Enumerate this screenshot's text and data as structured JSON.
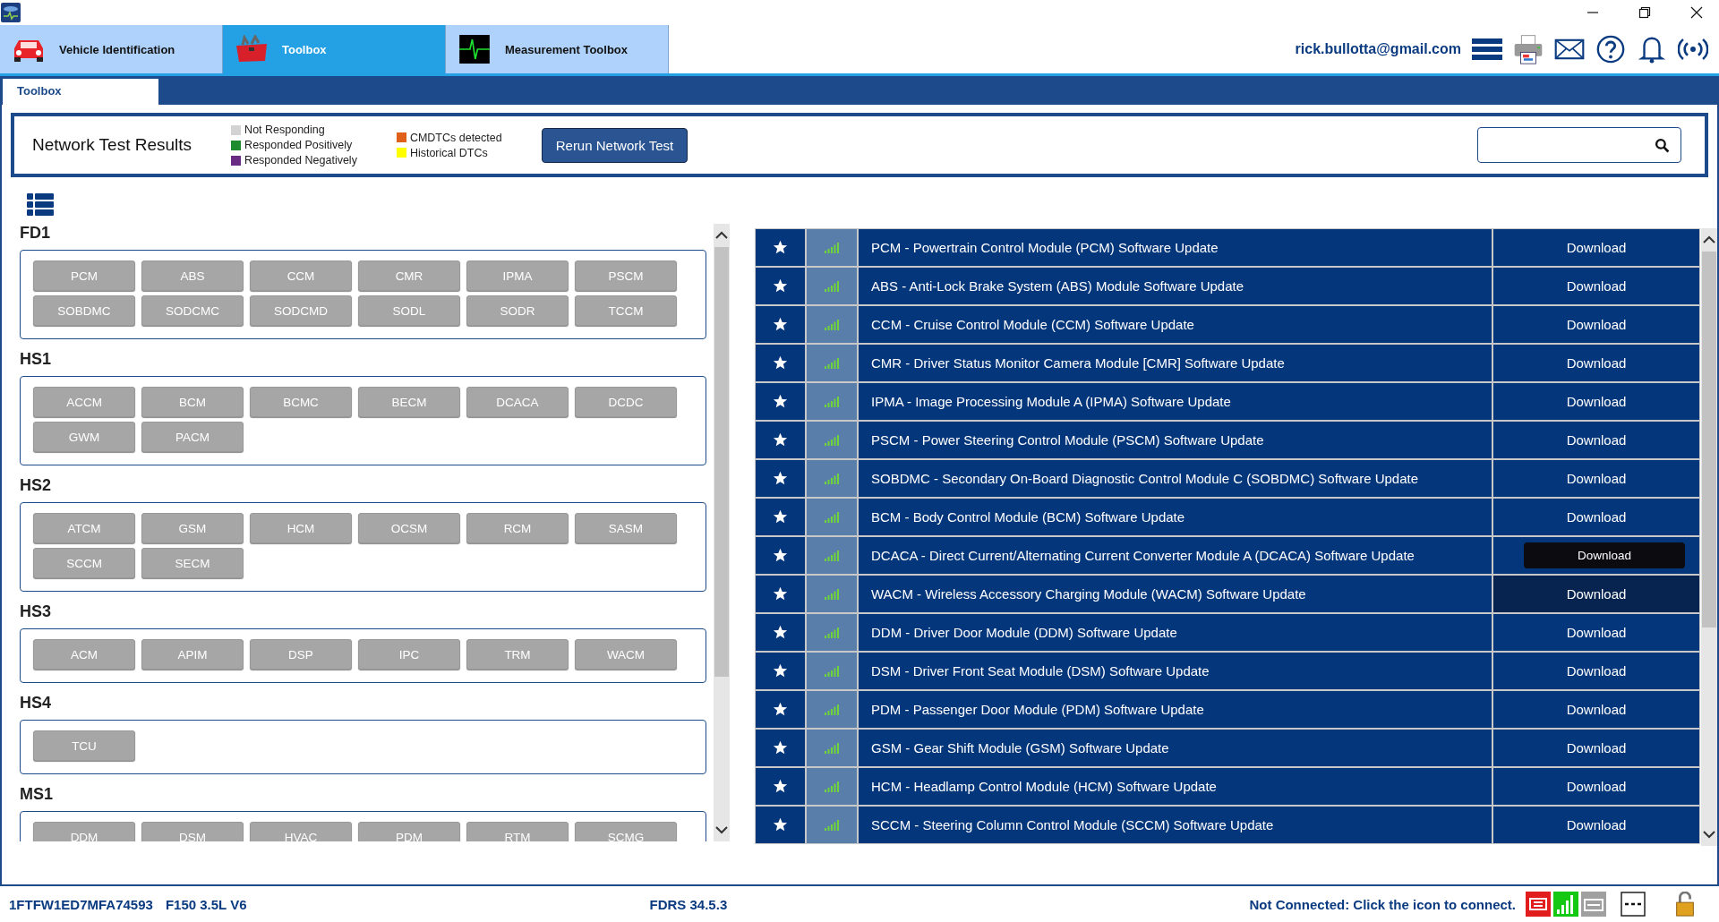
{
  "main_tabs": [
    {
      "label": "Vehicle Identification",
      "selected": false,
      "kind": "car"
    },
    {
      "label": "Toolbox",
      "selected": true,
      "kind": "toolbox"
    },
    {
      "label": "Measurement Toolbox",
      "selected": false,
      "kind": "scope"
    }
  ],
  "user": "rick.bullotta@gmail.com",
  "sub_tabs": [
    {
      "label": "Toolbox",
      "selected": true
    }
  ],
  "header": {
    "title": "Network Test Results",
    "legend": [
      [
        {
          "label": "Not Responding",
          "color": "#d3d3d3"
        },
        {
          "label": "Responded Positively",
          "color": "#1e8c2e"
        },
        {
          "label": "Responded Negatively",
          "color": "#6a2c82"
        }
      ],
      [
        {
          "label": "CMDTCs detected",
          "color": "#e0601a"
        },
        {
          "label": "Historical DTCs",
          "color": "#ffff00"
        }
      ]
    ],
    "rerun_button": "Rerun Network Test"
  },
  "networks": [
    {
      "name": "FD1",
      "modules": [
        "PCM",
        "ABS",
        "CCM",
        "CMR",
        "IPMA",
        "PSCM",
        "SOBDMC",
        "SODCMC",
        "SODCMD",
        "SODL",
        "SODR",
        "TCCM"
      ]
    },
    {
      "name": "HS1",
      "modules": [
        "ACCM",
        "BCM",
        "BCMC",
        "BECM",
        "DCACA",
        "DCDC",
        "GWM",
        "PACM"
      ]
    },
    {
      "name": "HS2",
      "modules": [
        "ATCM",
        "GSM",
        "HCM",
        "OCSM",
        "RCM",
        "SASM",
        "SCCM",
        "SECM"
      ]
    },
    {
      "name": "HS3",
      "modules": [
        "ACM",
        "APIM",
        "DSP",
        "IPC",
        "TRM",
        "WACM"
      ]
    },
    {
      "name": "HS4",
      "modules": [
        "TCU"
      ]
    },
    {
      "name": "MS1",
      "modules": [
        "DDM",
        "DSM",
        "HVAC",
        "PDM",
        "RTM",
        "SCMG"
      ]
    }
  ],
  "updates": [
    {
      "description": "PCM - Powertrain Control Module (PCM) Software Update",
      "action": "Download",
      "hovered": false
    },
    {
      "description": "ABS - Anti-Lock Brake System (ABS) Module Software Update",
      "action": "Download",
      "hovered": false
    },
    {
      "description": "CCM - Cruise Control Module (CCM) Software Update",
      "action": "Download",
      "hovered": false
    },
    {
      "description": "CMR - Driver Status Monitor Camera Module [CMR] Software Update",
      "action": "Download",
      "hovered": false
    },
    {
      "description": "IPMA - Image Processing Module A (IPMA) Software Update",
      "action": "Download",
      "hovered": false
    },
    {
      "description": "PSCM - Power Steering Control Module (PSCM) Software Update",
      "action": "Download",
      "hovered": false
    },
    {
      "description": "SOBDMC - Secondary On-Board Diagnostic Control Module C (SOBDMC) Software Update",
      "action": "Download",
      "hovered": false
    },
    {
      "description": "BCM - Body Control Module (BCM) Software Update",
      "action": "Download",
      "hovered": false
    },
    {
      "description": "DCACA - Direct Current/Alternating Current Converter Module A (DCACA) Software Update",
      "hovered": false
    },
    {
      "description": "WACM - Wireless Accessory Charging Module (WACM) Software Update",
      "action": "Download",
      "hovered": true,
      "tooltip": "Download"
    },
    {
      "description": "DDM - Driver Door Module (DDM) Software Update",
      "action": "Download",
      "hovered": false
    },
    {
      "description": "DSM - Driver Front Seat Module (DSM) Software Update",
      "action": "Download",
      "hovered": false
    },
    {
      "description": "PDM - Passenger Door Module (PDM) Software Update",
      "action": "Download",
      "hovered": false
    },
    {
      "description": "GSM - Gear Shift Module (GSM) Software Update",
      "action": "Download",
      "hovered": false
    },
    {
      "description": "HCM - Headlamp Control Module (HCM) Software Update",
      "action": "Download",
      "hovered": false
    },
    {
      "description": "SCCM - Steering Column Control Module (SCCM) Software Update",
      "action": "Download",
      "hovered": false
    }
  ],
  "status_bar": {
    "vin": "1FTFW1ED7MFA74593",
    "vehicle": "F150 3.5L V6",
    "version": "FDRS 34.5.3",
    "connection": "Not Connected: Click the icon to connect."
  }
}
